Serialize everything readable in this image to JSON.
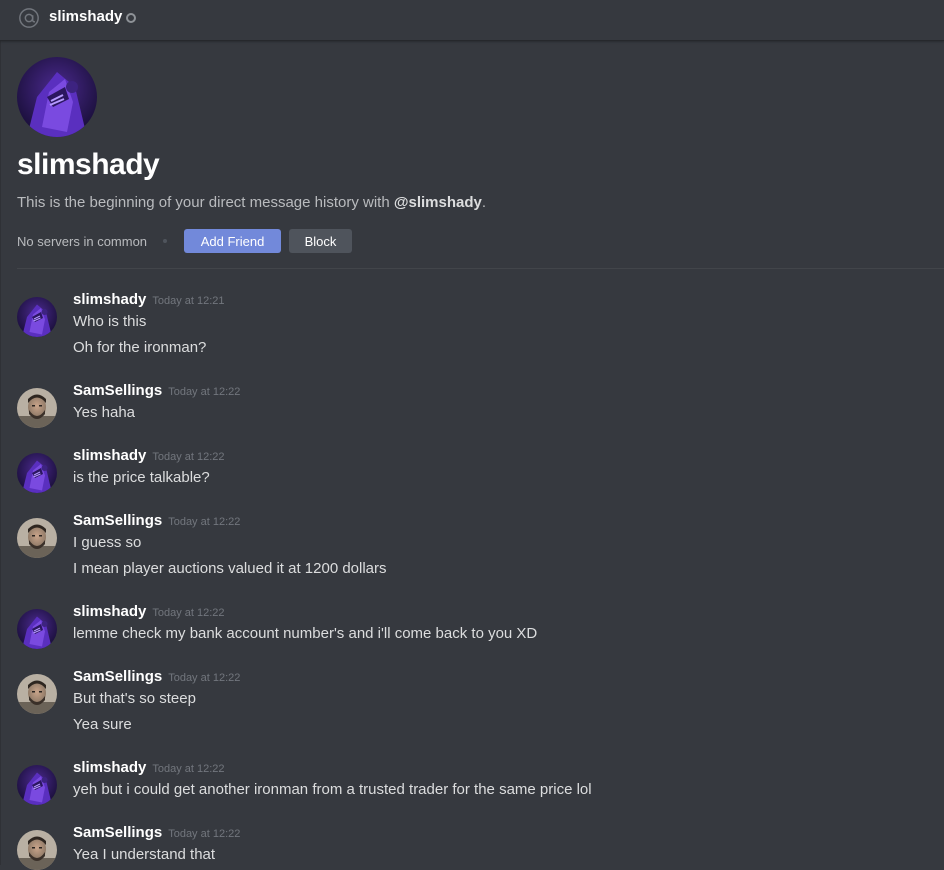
{
  "header": {
    "title": "slimshady"
  },
  "intro": {
    "name": "slimshady",
    "text_prefix": "This is the beginning of your direct message history with ",
    "text_handle": "@slimshady",
    "text_suffix": ".",
    "servers": "No servers in common",
    "add_friend": "Add Friend",
    "block": "Block"
  },
  "messages": [
    {
      "author": "slimshady",
      "time": "Today at 12:21",
      "lines": [
        "Who is this",
        "Oh for the ironman?"
      ]
    },
    {
      "author": "SamSellings",
      "time": "Today at 12:22",
      "lines": [
        "Yes haha"
      ]
    },
    {
      "author": "slimshady",
      "time": "Today at 12:22",
      "lines": [
        "is the price talkable?"
      ]
    },
    {
      "author": "SamSellings",
      "time": "Today at 12:22",
      "lines": [
        "I guess so",
        "I mean player auctions valued it at 1200 dollars"
      ]
    },
    {
      "author": "slimshady",
      "time": "Today at 12:22",
      "lines": [
        "lemme check my bank account number's and i'll come back to you XD"
      ]
    },
    {
      "author": "SamSellings",
      "time": "Today at 12:22",
      "lines": [
        "But that's so steep",
        "Yea sure"
      ]
    },
    {
      "author": "slimshady",
      "time": "Today at 12:22",
      "lines": [
        "yeh but i could get another ironman from a trusted trader for the same price lol"
      ]
    },
    {
      "author": "SamSellings",
      "time": "Today at 12:22",
      "lines": [
        "Yea I understand that"
      ]
    }
  ]
}
